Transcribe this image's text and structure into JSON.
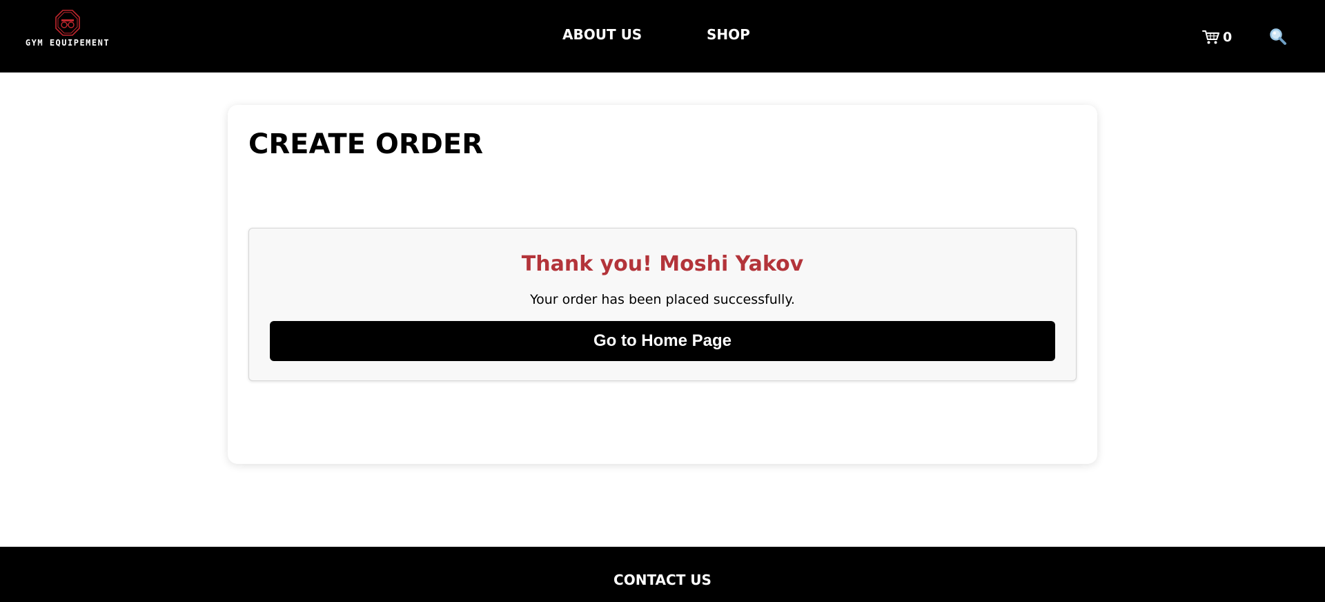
{
  "header": {
    "logo_text": "GYM EQUIPEMENT",
    "logo_icon": "gym-logo-icon",
    "nav": [
      {
        "label": "ABOUT US"
      },
      {
        "label": "SHOP"
      }
    ],
    "cart": {
      "icon": "cart-icon",
      "count": "0"
    },
    "search": {
      "icon": "search-icon"
    }
  },
  "main": {
    "title": "CREATE ORDER",
    "success": {
      "heading": "Thank you! Moshi Yakov",
      "message": "Your order has been placed successfully.",
      "button_label": "Go to Home Page"
    }
  },
  "footer": {
    "contact_label": "CONTACT US"
  },
  "colors": {
    "header_bg": "#000000",
    "accent_red": "#b3343a",
    "button_bg": "#000000",
    "success_bg": "#f8f8f8"
  }
}
